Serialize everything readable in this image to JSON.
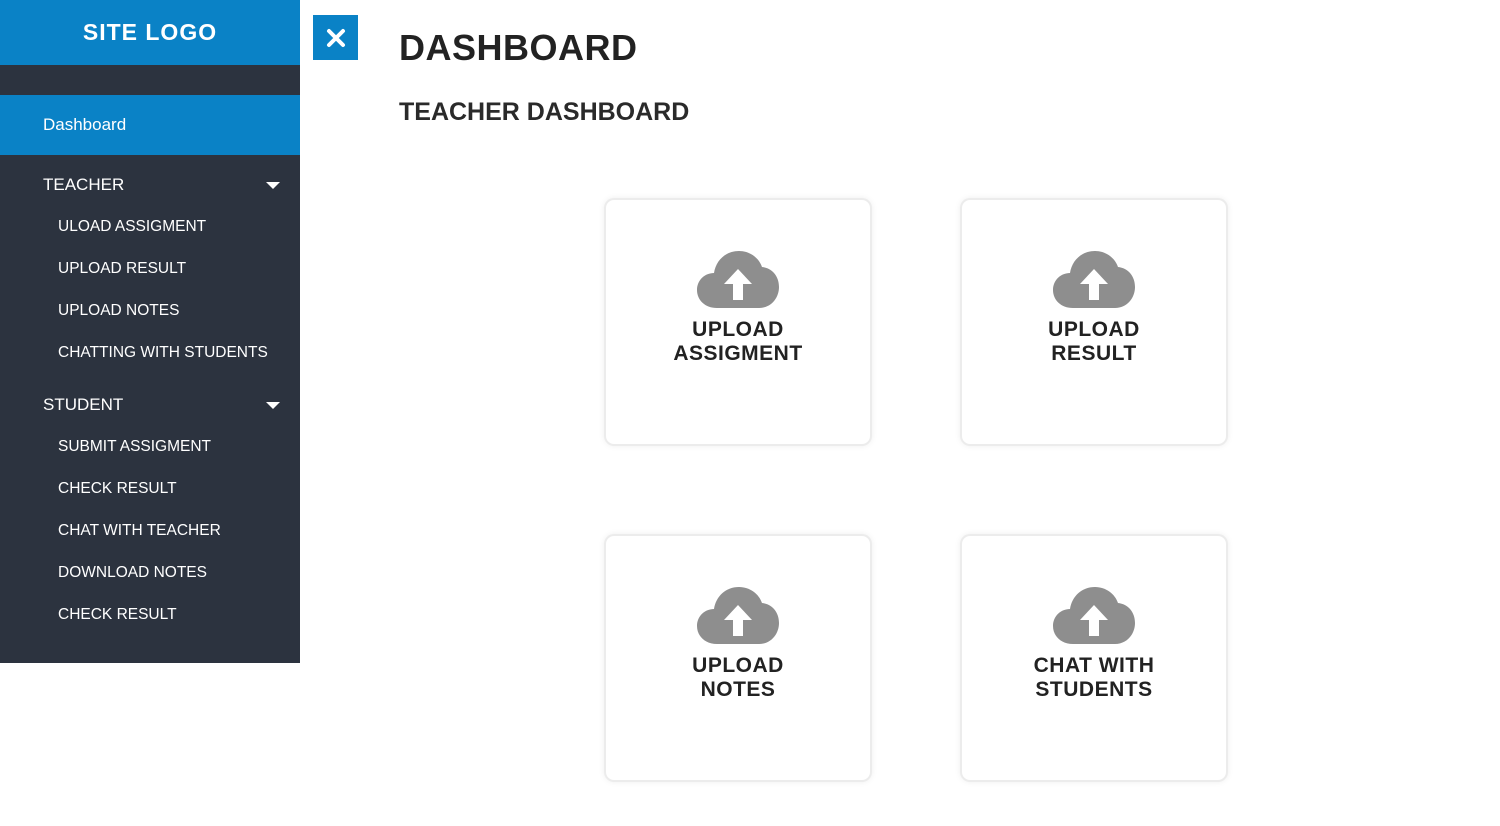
{
  "sidebar": {
    "logo": "SITE LOGO",
    "active_item": "Dashboard",
    "groups": [
      {
        "label": "TEACHER",
        "items": [
          "ULOAD ASSIGMENT",
          "UPLOAD RESULT",
          "UPLOAD NOTES",
          "CHATTING WITH STUDENTS"
        ]
      },
      {
        "label": "STUDENT",
        "items": [
          "SUBMIT ASSIGMENT",
          "CHECK RESULT",
          "CHAT WITH TEACHER",
          "DOWNLOAD NOTES",
          "CHECK RESULT"
        ]
      }
    ]
  },
  "header": {
    "title": "DASHBOARD",
    "subtitle": "TEACHER DASHBOARD"
  },
  "cards": [
    {
      "icon": "cloud-upload-icon",
      "line1": "UPLOAD",
      "line2": "ASSIGMENT"
    },
    {
      "icon": "cloud-upload-icon",
      "line1": "UPLOAD",
      "line2": "RESULT"
    },
    {
      "icon": "cloud-upload-icon",
      "line1": "UPLOAD",
      "line2": "NOTES"
    },
    {
      "icon": "cloud-upload-icon",
      "line1": "CHAT WITH",
      "line2": "STUDENTS"
    }
  ],
  "colors": {
    "accent": "#0a82c6",
    "sidebar_bg": "#2c333f",
    "icon_gray": "#8e8e8e"
  }
}
